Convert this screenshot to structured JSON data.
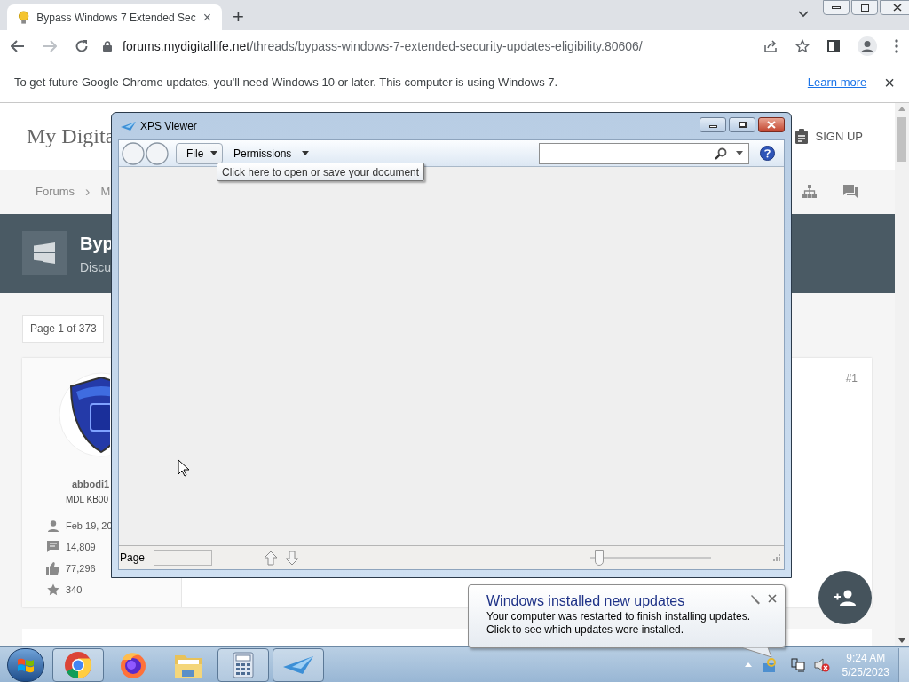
{
  "browser": {
    "tabs": [
      {
        "title": "Bypass Windows 7 Extended Sec",
        "close": "×",
        "selected": true
      }
    ],
    "new_tab": "+",
    "url": {
      "host": "forums.mydigitallife.net",
      "path": "/threads/bypass-windows-7-extended-security-updates-eligibility.80606/"
    },
    "infobar": {
      "message": "To get future Google Chrome updates, you'll need Windows 10 or later. This computer is using Windows 7.",
      "link": "Learn more",
      "close": "×"
    }
  },
  "page": {
    "logo": "My Digita",
    "signup": "SIGN UP",
    "breadcrumb": [
      {
        "label": "Forums"
      },
      {
        "label": "M"
      }
    ],
    "separator": "›",
    "thread_title": "Byp",
    "thread_subtitle": "Discu",
    "pagination": "Page 1 of 373",
    "post": {
      "author": "abbodi1",
      "rank": "MDL KB00",
      "number": "#1",
      "stats": [
        {
          "kind": "joined",
          "text": "Feb 19, 20"
        },
        {
          "kind": "messages",
          "text": "14,809"
        },
        {
          "kind": "likes",
          "text": "77,296"
        },
        {
          "kind": "points",
          "text": "340"
        }
      ]
    }
  },
  "xps_viewer": {
    "title": "XPS Viewer",
    "menus": [
      {
        "label": "File"
      },
      {
        "label": "Permissions"
      }
    ],
    "tooltip": "Click here to open or save your document",
    "page_label": "Page",
    "zoom": {
      "level": 0.04
    }
  },
  "notification": {
    "title": "Windows installed new updates",
    "lines": [
      "Your computer was restarted to finish installing updates.",
      "Click to see which updates were installed."
    ]
  },
  "taskbar": {
    "apps": [
      {
        "kind": "chrome",
        "running": true
      },
      {
        "kind": "firefox",
        "running": false
      },
      {
        "kind": "explorer",
        "running": false
      },
      {
        "kind": "calculator",
        "running": true
      },
      {
        "kind": "xps",
        "running": true
      }
    ],
    "time": "9:24 AM",
    "date": "5/25/2023"
  }
}
